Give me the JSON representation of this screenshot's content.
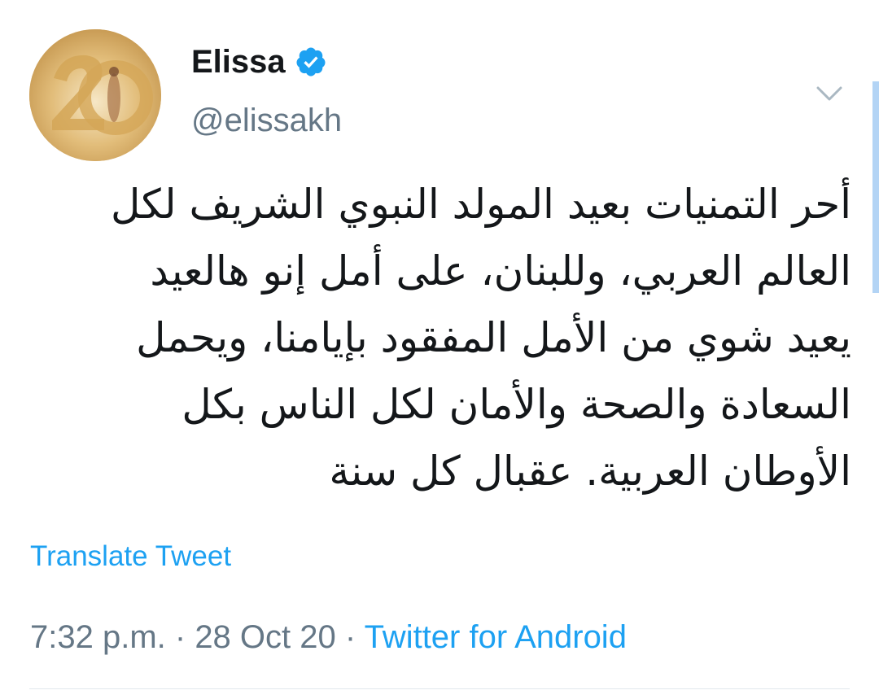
{
  "author": {
    "display_name": "Elissa",
    "handle": "@elissakh",
    "verified": true,
    "verified_icon": "verified-badge-icon",
    "avatar_icon": "profile-avatar"
  },
  "tweet": {
    "lines": [
      "أحر التمنيات بعيد المولد النبوي الشريف لكل",
      "العالم العربي، وللبنان، على أمل إنو هالعيد",
      "يعيد شوي من الأمل المفقود بإيامنا، ويحمل",
      "السعادة والصحة والأمان لكل الناس بكل",
      "الأوطان العربية. عقبال كل سنة"
    ],
    "translate_label": "Translate Tweet"
  },
  "meta": {
    "time": "7:32 p.m.",
    "separator": " · ",
    "date": "28 Oct 20",
    "source": "Twitter for Android"
  },
  "menu": {
    "icon": "chevron-down-icon"
  },
  "colors": {
    "link": "#1da1f2",
    "secondary_text": "#657786",
    "primary_text": "#14171a",
    "divider": "#e1e8ed"
  }
}
